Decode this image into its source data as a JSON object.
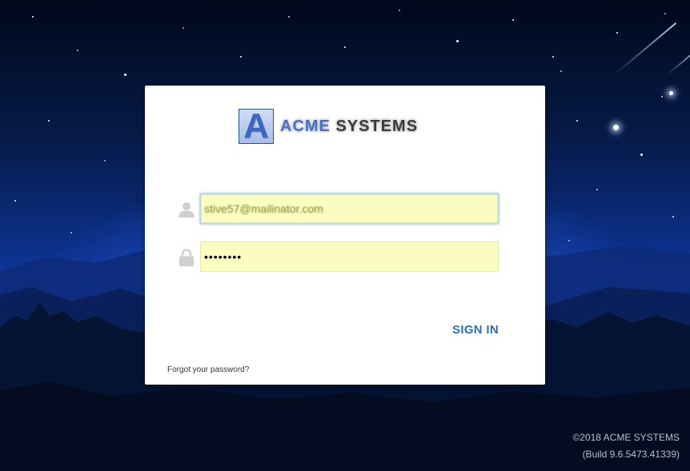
{
  "background": {
    "theme": "night-sky-with-meteors-and-mountains"
  },
  "brand": {
    "logo_letter": "A",
    "name_part1": "ACME",
    "name_part2": "SYSTEMS",
    "accent_color": "#3a67c4"
  },
  "login": {
    "username_icon": "user-icon",
    "username_value": "stive57@mailinator.com",
    "password_icon": "lock-icon",
    "password_value": "••••••••",
    "input_background": "#fafcc0",
    "signin_label": "SIGN IN",
    "signin_color": "#2a6fb8",
    "forgot_label": "Forgot your password?"
  },
  "footer": {
    "copyright": "©2018 ACME SYSTEMS",
    "build": "(Build 9.6.5473.41339)"
  }
}
